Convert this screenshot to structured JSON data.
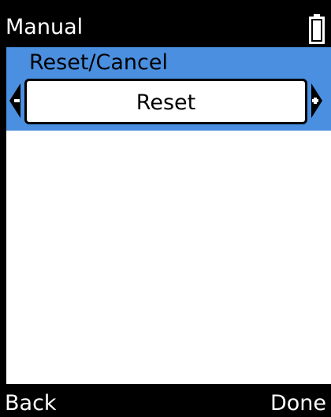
{
  "header": {
    "title": "Manual",
    "battery_icon": "battery-icon"
  },
  "setting": {
    "label": "Reset/Cancel",
    "value": "Reset",
    "decrease_icon": "arrow-left-minus-icon",
    "increase_icon": "arrow-right-plus-icon"
  },
  "softkeys": {
    "left": "Back",
    "right": "Done"
  },
  "colors": {
    "selection": "#4a8fe0",
    "background": "#ffffff",
    "bars": "#000000"
  }
}
